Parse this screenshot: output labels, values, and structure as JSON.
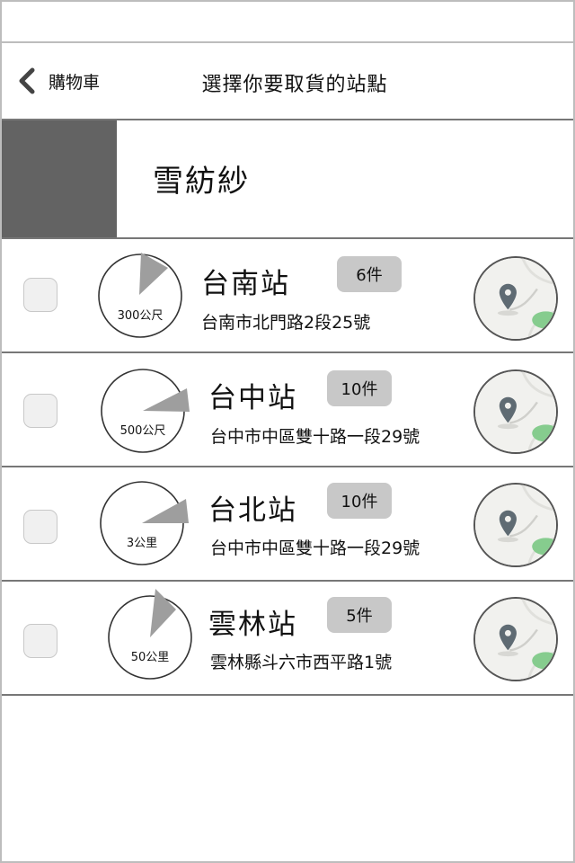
{
  "nav": {
    "back_label": "購物車",
    "back_icon": "chevron-left-icon",
    "title": "選擇你要取貨的站點"
  },
  "store": {
    "name": "雪紡紗"
  },
  "stations": [
    {
      "name": "台南站",
      "count": "6件",
      "address": "台南市北門路2段25號",
      "distance": "300公尺",
      "map_icon": "map-pin-icon"
    },
    {
      "name": "台中站",
      "count": "10件",
      "address": "台中市中區雙十路一段29號",
      "distance": "500公尺",
      "map_icon": "map-pin-icon"
    },
    {
      "name": "台北站",
      "count": "10件",
      "address": "台中市中區雙十路一段29號",
      "distance": "3公里",
      "map_icon": "map-pin-icon"
    },
    {
      "name": "雲林站",
      "count": "5件",
      "address": "雲林縣斗六市西平路1號",
      "distance": "50公里",
      "map_icon": "map-pin-icon"
    }
  ],
  "colors": {
    "store_logo": "#636363",
    "badge": "#c8c8c8",
    "pointer": "#9e9e9e",
    "map_park": "#86cc8e",
    "map_pin": "#5f6b73"
  }
}
